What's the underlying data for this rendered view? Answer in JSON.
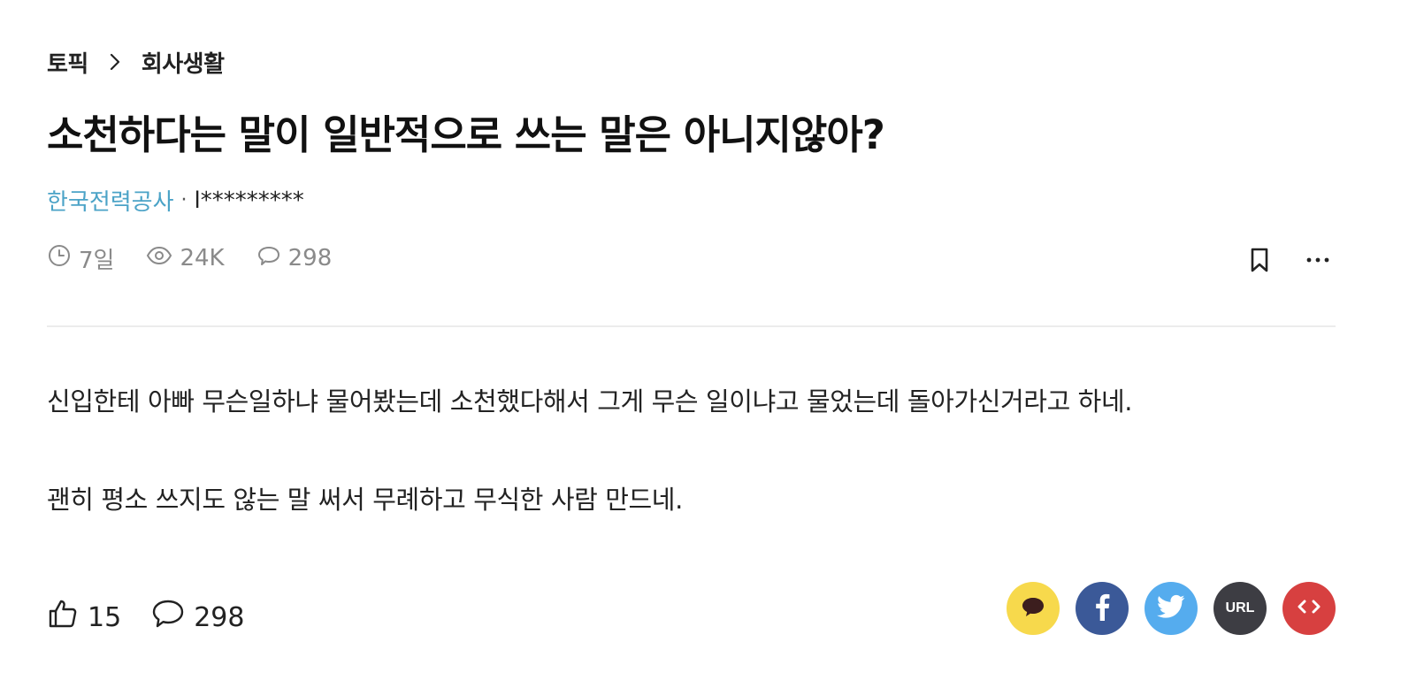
{
  "breadcrumb": {
    "root": "토픽",
    "current": "회사생활"
  },
  "post": {
    "title": "소천하다는 말이 일반적으로 쓰는 말은 아니지않아?",
    "company": "한국전력공사",
    "separator": "·",
    "nickname": "l*********",
    "time_ago": "7일",
    "views": "24K",
    "comments": "298",
    "body": [
      "신입한테 아빠 무슨일하냐 물어봤는데 소천했다해서 그게 무슨 일이냐고 물었는데 돌아가신거라고 하네.",
      "괜히 평소 쓰지도 않는 말 써서 무례하고 무식한 사람 만드네."
    ]
  },
  "footer": {
    "likes": "15",
    "comments": "298"
  },
  "share": {
    "url_label": "URL"
  },
  "colors": {
    "company_link": "#4ba3c7",
    "kakao": "#f7d94c",
    "facebook": "#3b5998",
    "twitter": "#55acee",
    "url": "#3d3d43",
    "embed": "#d74040"
  },
  "icons": [
    "chevron-right-icon",
    "clock-icon",
    "eye-icon",
    "comment-icon",
    "bookmark-icon",
    "more-icon",
    "thumbs-up-icon",
    "kakao-icon",
    "facebook-icon",
    "twitter-icon",
    "embed-code-icon"
  ]
}
